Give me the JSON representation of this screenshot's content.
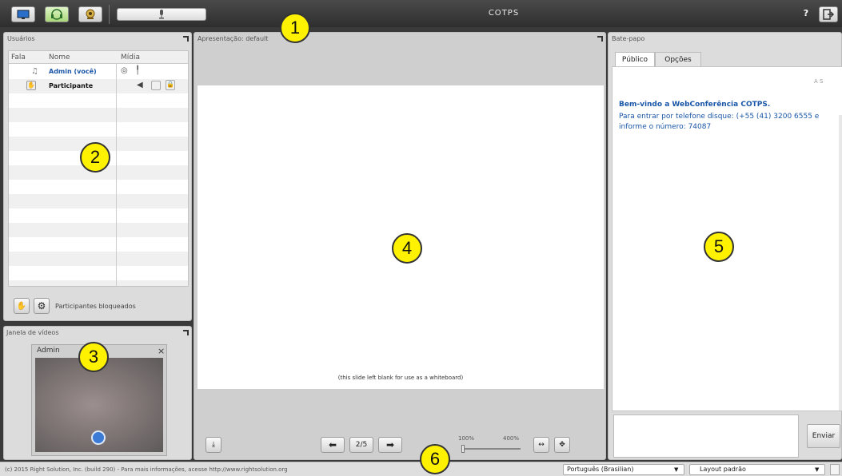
{
  "app": {
    "title": "COTPS"
  },
  "topbar": {
    "help_label": "?",
    "mic_icon": "mic-icon"
  },
  "users_panel": {
    "title": "Usuários",
    "columns": [
      "Fala",
      "Nome",
      "Mídia"
    ],
    "users": [
      {
        "name": "Admin (você)"
      },
      {
        "name": "Participante"
      }
    ],
    "footer_label": "Participantes bloqueados"
  },
  "video_panel": {
    "title": "Janela de vídeos",
    "video_user": "Admin",
    "close_label": "×"
  },
  "presentation": {
    "title": "Apresentação: default",
    "slide_caption": "(this slide left blank for use as a whiteboard)",
    "page_label": "2/5",
    "zoom_min": "100%",
    "zoom_max": "400%"
  },
  "chat": {
    "title": "Bate-papo",
    "tabs": [
      "Público",
      "Opções"
    ],
    "font_controls": "A S",
    "welcome": "Bem-vindo a WebConferência COTPS.",
    "message": "Para entrar por telefone disque: (+55 (41) 3200 6555 e informe o número: 74087",
    "send_label": "Enviar"
  },
  "statusbar": {
    "copyright": "(c) 2015 Right Solution, Inc. (build 290) - Para mais informações, acesse http://www.rightsolution.org",
    "language": "Português (Brasilian)",
    "layout": "Layout padrão"
  },
  "callouts": [
    "1",
    "2",
    "3",
    "4",
    "5",
    "6"
  ],
  "colors": {
    "accent_blue": "#1a56a8",
    "callout_yellow": "#fff200",
    "topbar": "#3a3a3a"
  }
}
